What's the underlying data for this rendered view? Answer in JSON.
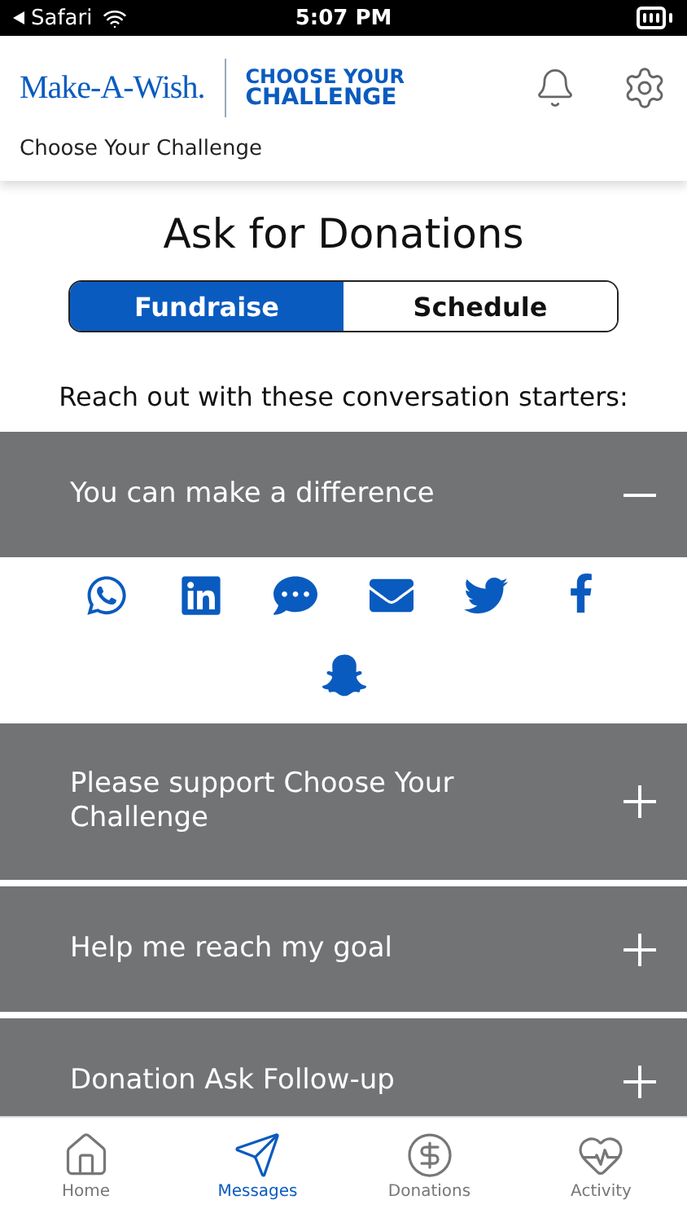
{
  "status_bar": {
    "back_app": "Safari",
    "time": "5:07 PM"
  },
  "header": {
    "logo_left": "Make-A-Wish.",
    "logo_right_top": "CHOOSE YOUR",
    "logo_right_bottom": "CHALLENGE",
    "subtitle": "Choose Your Challenge"
  },
  "page_title": "Ask for Donations",
  "segments": [
    {
      "label": "Fundraise",
      "selected": true
    },
    {
      "label": "Schedule",
      "selected": false
    }
  ],
  "intro": "Reach out with these conversation starters:",
  "sections": [
    {
      "title": "You can make a difference",
      "expanded": true,
      "share_options": [
        {
          "kind": "whatsapp"
        },
        {
          "kind": "linkedin"
        },
        {
          "kind": "chat"
        },
        {
          "kind": "mail"
        },
        {
          "kind": "twitter"
        },
        {
          "kind": "facebook"
        },
        {
          "kind": "snapchat"
        }
      ]
    },
    {
      "title": "Please support Choose Your Challenge",
      "expanded": false
    },
    {
      "title": "Help me reach my goal",
      "expanded": false
    },
    {
      "title": "Donation Ask Follow-up",
      "expanded": false
    }
  ],
  "tab_bar": [
    {
      "label": "Home",
      "kind": "home",
      "selected": false
    },
    {
      "label": "Messages",
      "kind": "messages",
      "selected": true
    },
    {
      "label": "Donations",
      "kind": "donations",
      "selected": false
    },
    {
      "label": "Activity",
      "kind": "activity",
      "selected": false
    }
  ]
}
